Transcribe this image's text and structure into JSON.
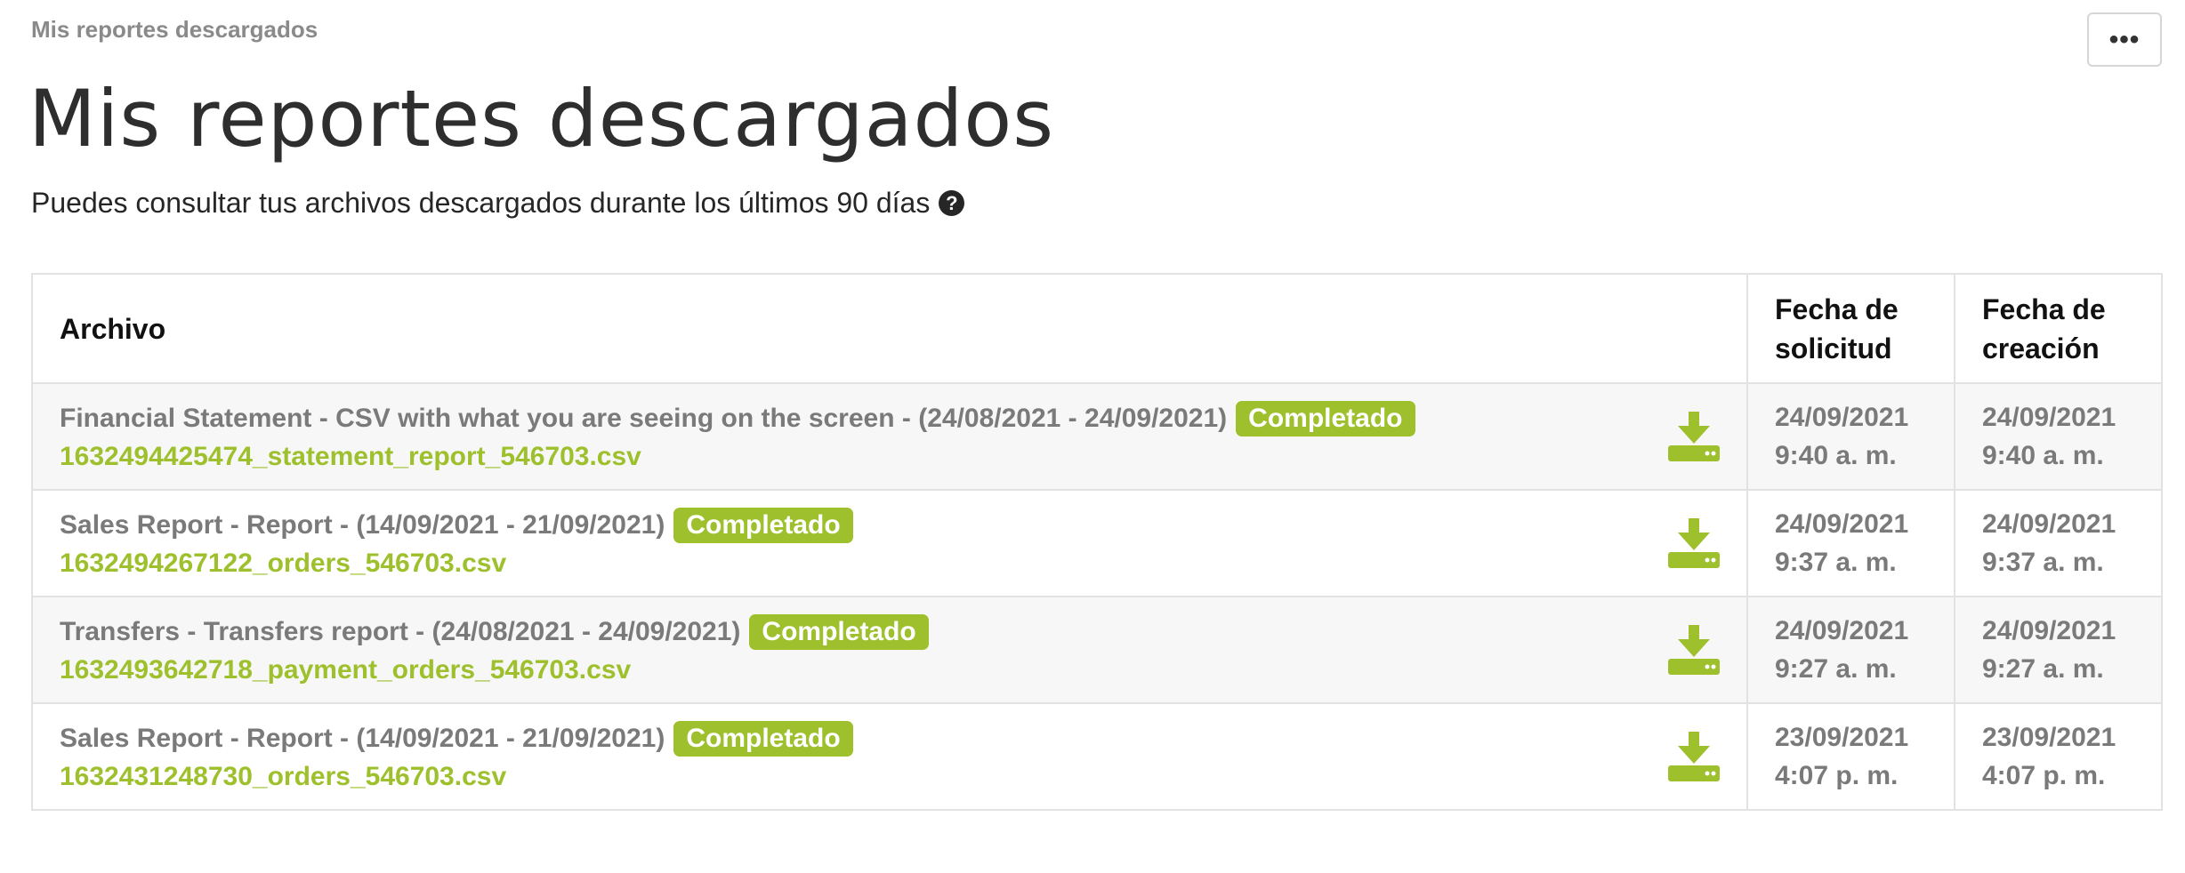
{
  "breadcrumb": "Mis reportes descargados",
  "more_button": "•••",
  "title": "Mis reportes descargados",
  "subtitle": "Puedes consultar tus archivos descargados durante los últimos 90 días",
  "help_icon": "question-circle-icon",
  "accent_color": "#9dc02c",
  "table": {
    "headers": {
      "file": "Archivo",
      "requested_line1": "Fecha de",
      "requested_line2": "solicitud",
      "created_line1": "Fecha de",
      "created_line2": "creación"
    },
    "rows": [
      {
        "description": "Financial Statement - CSV with what you are seeing on the screen - (24/08/2021 - 24/09/2021)",
        "status": "Completado",
        "filename": "1632494425474_statement_report_546703.csv",
        "requested_date": "24/09/2021",
        "requested_time": "9:40 a. m.",
        "created_date": "24/09/2021",
        "created_time": "9:40 a. m."
      },
      {
        "description": "Sales Report - Report - (14/09/2021 - 21/09/2021)",
        "status": "Completado",
        "filename": "1632494267122_orders_546703.csv",
        "requested_date": "24/09/2021",
        "requested_time": "9:37 a. m.",
        "created_date": "24/09/2021",
        "created_time": "9:37 a. m."
      },
      {
        "description": "Transfers - Transfers report - (24/08/2021 - 24/09/2021)",
        "status": "Completado",
        "filename": "1632493642718_payment_orders_546703.csv",
        "requested_date": "24/09/2021",
        "requested_time": "9:27 a. m.",
        "created_date": "24/09/2021",
        "created_time": "9:27 a. m."
      },
      {
        "description": "Sales Report - Report - (14/09/2021 - 21/09/2021)",
        "status": "Completado",
        "filename": "1632431248730_orders_546703.csv",
        "requested_date": "23/09/2021",
        "requested_time": "4:07 p. m.",
        "created_date": "23/09/2021",
        "created_time": "4:07 p. m."
      }
    ]
  }
}
